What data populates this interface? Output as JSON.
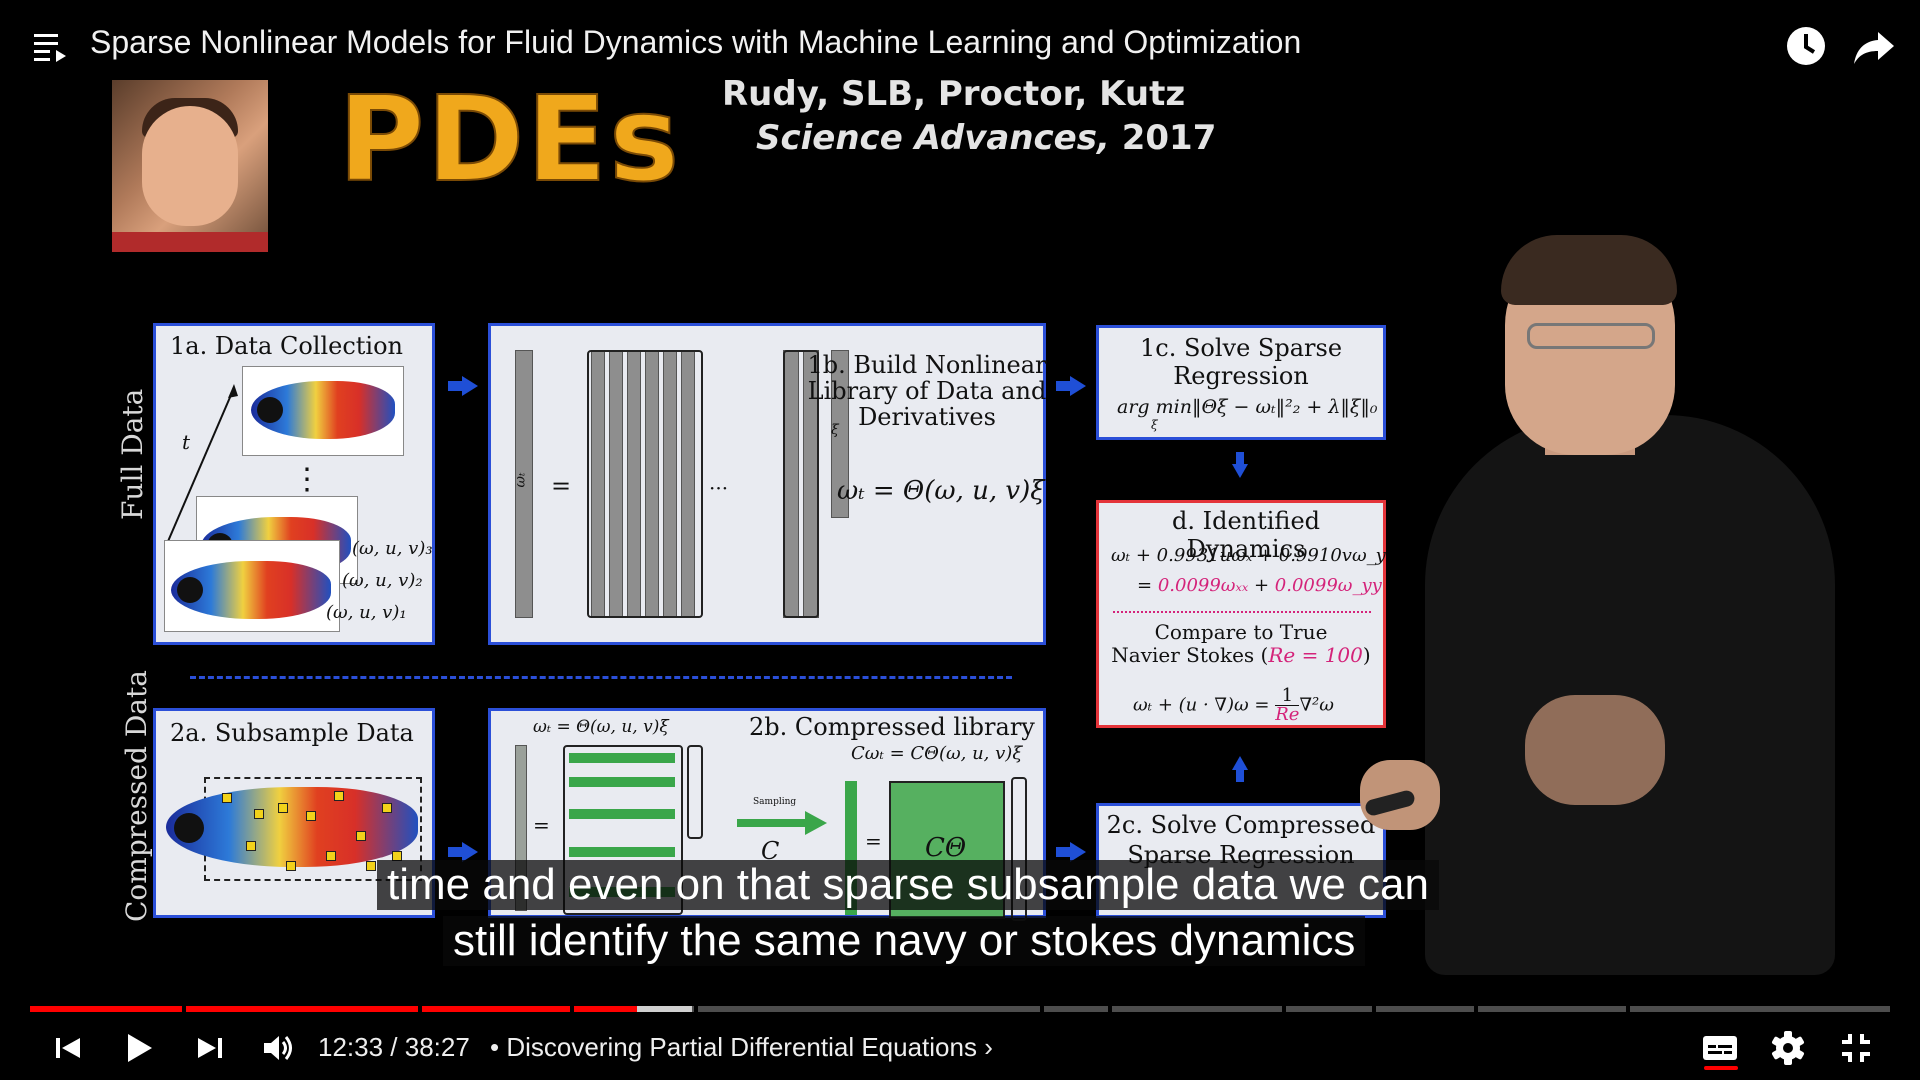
{
  "video": {
    "title": "Sparse Nonlinear Models for Fluid Dynamics with Machine Learning and Optimization"
  },
  "slide": {
    "heading": "PDEs",
    "authors": "Rudy, SLB, Proctor, Kutz",
    "journal": "Science Advances,",
    "year": " 2017",
    "side_labels": [
      "Full Data",
      "Compressed Data"
    ],
    "panels": {
      "p1a": {
        "title": "1a.  Data Collection",
        "t_label": "t",
        "dots": "⋮",
        "states": [
          "(ω, u, v)₃",
          "(ω, u, v)₂",
          "(ω, u, v)₁"
        ]
      },
      "p1b": {
        "title_lines": [
          "1b.  Build Nonlinear",
          "Library of Data and",
          "Derivatives"
        ],
        "equation": "ωₜ = Θ(ω, u, v)ξ",
        "lhs_label": "ωₜ",
        "equals": "=",
        "ellipsis": "···",
        "xi": "ξ"
      },
      "p1c": {
        "title_lines": [
          "1c.  Solve Sparse",
          "Regression"
        ],
        "formula": "arg min‖Θξ − ωₜ‖²₂ + λ‖ξ‖₀",
        "sub": "ξ"
      },
      "pd": {
        "title": "d.  Identified Dynamics",
        "line1": "ωₜ + 0.9931uωₓ + 0.9910vω_y",
        "line2_pre": "= ",
        "line2_a": "0.0099ωₓₓ",
        "line2_mid": " + ",
        "line2_b": "0.0099ω_yy",
        "compare": "Compare to True",
        "ns": "Navier Stokes (",
        "re": "Re = 100",
        "ns_end": ")",
        "final": "ωₜ + (u · ∇)ω = ",
        "frac_num": "1",
        "frac_den": "Re",
        "final_end": "∇²ω"
      },
      "p2a": {
        "title": "2a.  Subsample Data"
      },
      "p2b": {
        "title": "2b.  Compressed library",
        "sub_eq": "Cωₜ = CΘ(ω, u, v)ξ",
        "top_eq": "ωₜ = Θ(ω, u, v)ξ",
        "sampling": "Sampling",
        "c": "C",
        "ctheta": "CΘ",
        "equals": "="
      },
      "p2c": {
        "title_lines": [
          "2c.  Solve Compressed",
          "Sparse Regression"
        ]
      }
    }
  },
  "captions": [
    "time and even on that sparse subsample data we can",
    "still identify the same navy or stokes dynamics"
  ],
  "player": {
    "current_time": "12:33",
    "duration": "38:27",
    "time_display": "12:33 / 38:27",
    "chapter": "• Discovering Partial Differential Equations",
    "chapter_chevron": "›",
    "progress_fraction": 0.3264,
    "buffered_fraction": 0.356
  },
  "colors": {
    "played": "#ff0000",
    "panel_border_blue": "#2b4fd8",
    "panel_border_red": "#e4343a",
    "pdes_orange": "#f0a81c"
  },
  "icons": [
    "playlist-icon",
    "watch-later-icon",
    "share-icon",
    "previous-icon",
    "play-icon",
    "next-icon",
    "volume-icon",
    "subtitles-icon",
    "settings-icon",
    "exit-fullscreen-icon"
  ]
}
